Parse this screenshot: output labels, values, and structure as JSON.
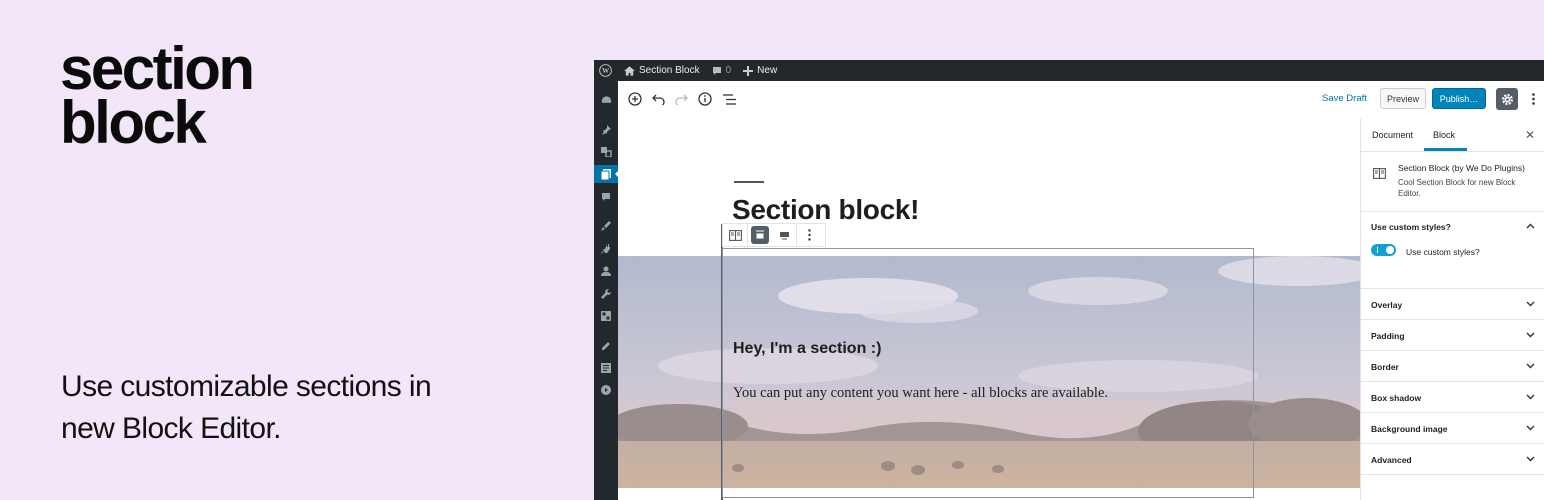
{
  "brand": {
    "line1": "section",
    "line2": "block"
  },
  "tagline": "Use customizable sections in new Block Editor.",
  "adminbar": {
    "site_name": "Section Block",
    "comments_count": "0",
    "new_label": "New"
  },
  "toolbar": {
    "save_draft": "Save Draft",
    "preview": "Preview",
    "publish": "Publish…"
  },
  "editor": {
    "post_title": "Section block!",
    "section_heading": "Hey, I'm a section :)",
    "section_paragraph": "You can put any content you want here - all blocks are available."
  },
  "sidebar": {
    "tab_document": "Document",
    "tab_block": "Block",
    "active_tab": "Block",
    "block_name": "Section Block (by We Do Plugins)",
    "block_description": "Cool Section Block for new Block Editor.",
    "custom_styles_panel": "Use custom styles?",
    "custom_styles_toggle_label": "Use custom styles?",
    "custom_styles_enabled": true,
    "panels": [
      "Overlay",
      "Padding",
      "Border",
      "Box shadow",
      "Background image",
      "Advanced"
    ]
  },
  "colors": {
    "accent": "#0085ba",
    "admin_bar": "#23282d",
    "background": "#f3e6f8",
    "toggle_on": "#11a0d2"
  }
}
